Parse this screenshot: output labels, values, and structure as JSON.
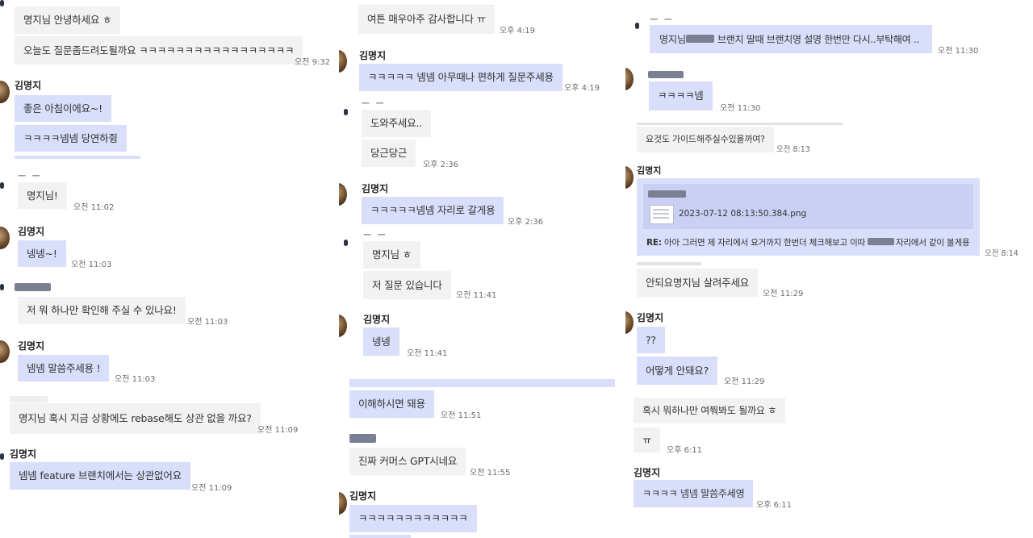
{
  "colors": {
    "incoming": "#f2f2f2",
    "outgoing": "#d9defa",
    "time": "#6b6b6b"
  },
  "icons": {
    "avatar": "profile-photo",
    "file": "image-file-icon"
  },
  "col1": {
    "m1": "명지님 안녕하세요 ㅎ",
    "m2": "오늘도 질문좀드려도될까요 ㅋㅋㅋㅋㅋㅋㅋㅋㅋㅋㅋㅋㅋㅋㅋㅋㅋ",
    "t2": "오전 9:32",
    "n1": "김명지",
    "m3": "좋은 아침이에요~!",
    "m4": "ㅋㅋㅋㅋ넴넴 당연하쥥",
    "d1": "ㅡ ㅡ",
    "m5": "명지님!",
    "t5": "오전 11:02",
    "n2": "김명지",
    "m6": "넹넹~!",
    "t6": "오전 11:03",
    "m7": "저 뭐 하나만 확인해 주실 수 있나요!",
    "t7": "오전 11:03",
    "n3": "김명지",
    "m8": "넴넴 말씀주세용 !",
    "t8": "오전 11:03",
    "m9": "명지님 혹시 지금 상황에도 rebase해도 상관 없을 까요?",
    "t9": "오전 11:09",
    "n4": "김명지",
    "m10": "넴넴 feature 브랜치에서는 상관없어요",
    "t10": "오전 11:09"
  },
  "col2": {
    "m1": "여튼 매우아주 감사합니다 ㅠ",
    "t1": "오후 4:19",
    "n1": "김명지",
    "m2": "ㅋㅋㅋㅋㅋ 넴넴 아무때나 편하게 질문주세용",
    "t2": "오후 4:19",
    "d1": "ㅡ ㅡ",
    "m3": "도와주세요..",
    "m4": "당근당근",
    "t4": "오후 2:36",
    "n2": "김명지",
    "m5": "ㅋㅋㅋㅋㅋ넴넴 자리로 갈게용",
    "t5": "오후 2:36",
    "d2": "ㅡ ㅡ",
    "m6": "명지님 ㅎ",
    "m7": "저 질문 있습니다",
    "t7": "오전 11:41",
    "n3": "김명지",
    "m8": "넹넹",
    "t8": "오전 11:41",
    "m9": "이해하시면 돼용",
    "t9": "오전 11:51",
    "m10": "진짜 커머스 GPT시네요",
    "t10": "오전 11:55",
    "n4": "김명지",
    "m11": "ㅋㅋㅋㅋㅋㅋㅋㅋㅋㅋㅋㅋ"
  },
  "col3": {
    "d1": "ㅡ ㅡ",
    "m1a": "명지님",
    "m1b": "브랜치 딸때 브랜치명 설명 한번만 다시..부탁해여 ..",
    "t1": "오전 11:30",
    "m2": "ㅋㅋㅋㅋ넴",
    "t2": "오전 11:30",
    "m3": "요것도 가이드해주실수있을까여?",
    "t3": "오전 8:13",
    "n1": "김명지",
    "fname": "2023-07-12 08:13:50.384.png",
    "re_label": "RE:",
    "re_a": "아아 그러면 제 자리에서 요거까지 한번더 체크해보고 이따",
    "re_b": "자리에서 같이 볼게용",
    "t4": "오전 8:14",
    "m5": "안되요명지님 살려주세요",
    "t5": "오전 11:29",
    "n2": "김명지",
    "m6": "??",
    "m7": "어떻게 안돼요?",
    "t7": "오전 11:29",
    "m8": "혹시 뭐하나만 여쭤봐도 될까요 ㅎ",
    "m9": "ㅠ",
    "t9": "오후 6:11",
    "n3": "김명지",
    "m10": "ㅋㅋㅋㅋ 넴넴 말씀주세영",
    "t10": "오후 6:11"
  }
}
